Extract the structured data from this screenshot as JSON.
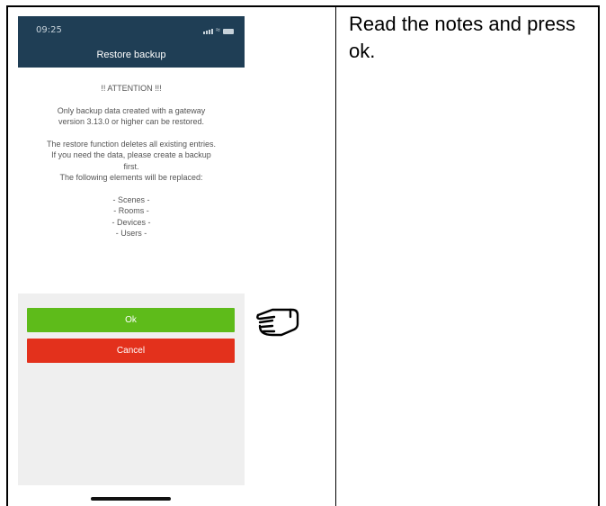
{
  "status_bar": {
    "time": "09:25"
  },
  "header": {
    "title": "Restore backup"
  },
  "notice": {
    "attention": "!! ATTENTION !!!",
    "line1": "Only backup data created with a gateway",
    "line2": "version 3.13.0 or higher can be restored.",
    "line3": "The restore function deletes all existing entries.",
    "line4": "If you need the data, please create a backup",
    "line5": "first.",
    "line6": "The following elements will be replaced:",
    "items": [
      "- Scenes -",
      "- Rooms -",
      "- Devices -",
      "- Users -"
    ]
  },
  "buttons": {
    "ok": "Ok",
    "cancel": "Cancel"
  },
  "instruction": "Read the notes and press ok.",
  "icons": {
    "pointer": "pointing-hand-icon"
  },
  "colors": {
    "header": "#1f3e55",
    "ok": "#5ebb1a",
    "cancel": "#e3311c",
    "panel": "#efefef"
  }
}
